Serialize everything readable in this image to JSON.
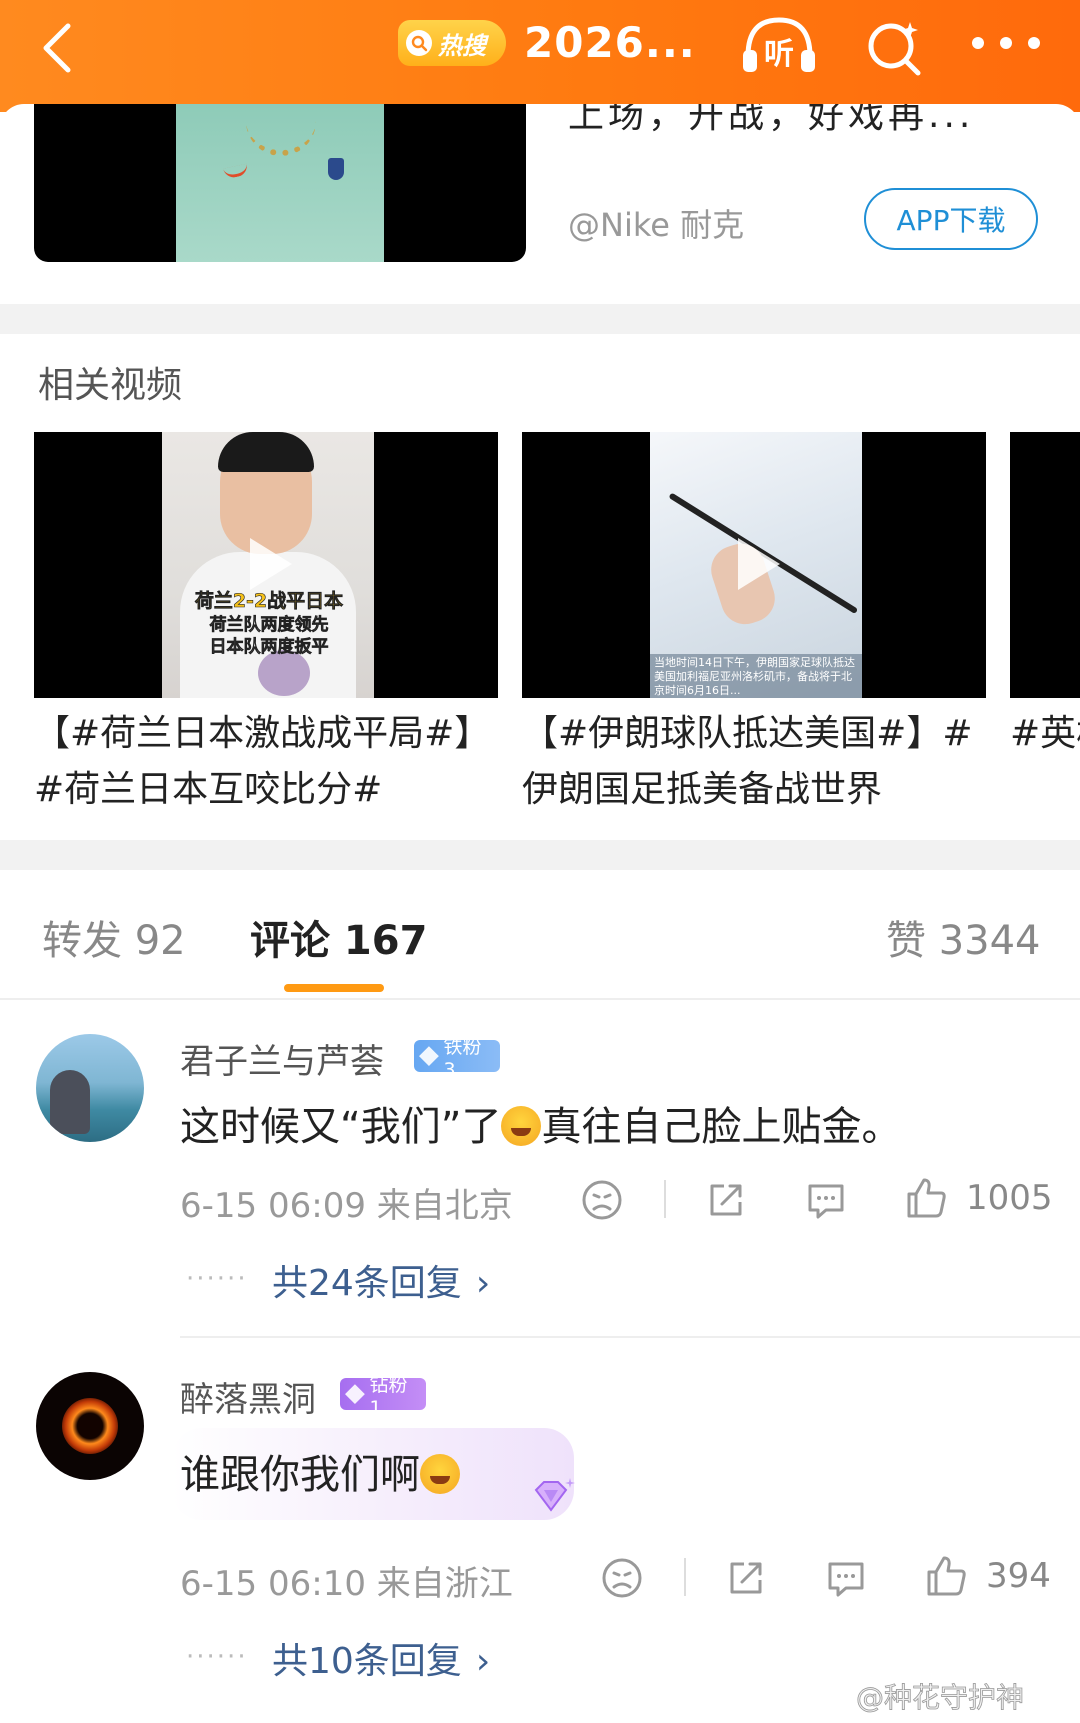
{
  "header": {
    "hot_search_label": "热搜",
    "title": "2026...",
    "listen_label": "听"
  },
  "ad": {
    "description": "上场，开战，好戏再...",
    "brand": "@Nike 耐克",
    "download_button": "APP下载"
  },
  "related_videos": {
    "section_title": "相关视频",
    "items": [
      {
        "title": "【#荷兰日本激战成平局#】#荷兰日本互咬比分#",
        "caption_1": "荷兰2-2战平日本",
        "caption_2": "荷兰队两度领先",
        "caption_3": "日本队两度扳平"
      },
      {
        "title": "【#伊朗球队抵达美国#】#伊朗国足抵美备战世界",
        "caption_1": "当地时间14日下午，伊朗国家足球队抵达美国加利福尼亚州洛杉矶市，备战将于北京时间6月16日..."
      },
      {
        "title": "#英格兰...劫#"
      }
    ]
  },
  "tabs": {
    "repost": "转发 92",
    "comment": "评论 167",
    "like": "赞 3344"
  },
  "comments": [
    {
      "username": "君子兰与芦荟",
      "badge": "铁粉3",
      "text_before": "这时候又“我们”了",
      "text_after": "真往自己脸上贴金。",
      "meta": "6-15 06:09 来自北京",
      "likes": "1005",
      "replies": "共24条回复"
    },
    {
      "username": "醉落黑洞",
      "badge": "钻粉1",
      "text_before": "谁跟你我们啊",
      "text_after": "",
      "meta": "6-15 06:10 来自浙江",
      "likes": "394",
      "replies": "共10条回复"
    }
  ],
  "watermark": "@种花守护神",
  "colors": {
    "header_orange": "#ff7a10",
    "accent_orange": "#ff9a13",
    "link_blue": "#3d5f8f",
    "ad_button_blue": "#1f8fd6"
  },
  "icons": [
    "back-arrow-icon",
    "search-icon",
    "headphones-icon",
    "search-sparkle-icon",
    "more-icon",
    "play-icon",
    "dislike-icon",
    "share-icon",
    "comment-icon",
    "like-icon",
    "chevron-right-icon"
  ]
}
